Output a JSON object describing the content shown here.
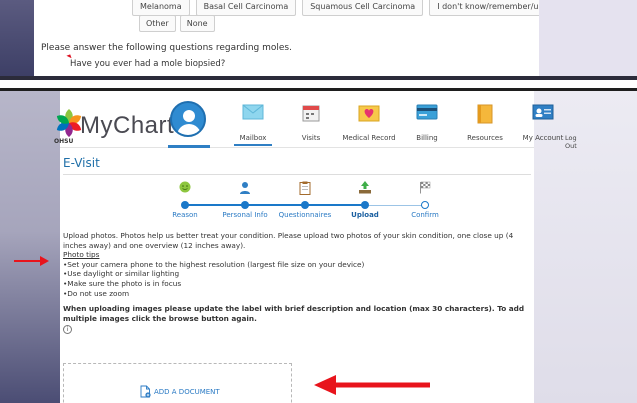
{
  "top_screenshot": {
    "chips_row1": [
      "Melanoma",
      "Basal Cell Carcinoma",
      "Squamous Cell Carcinoma",
      "I don't know/remember/unknown"
    ],
    "chips_row2": [
      "Other",
      "None"
    ],
    "question_intro": "Please answer the following questions regarding moles.",
    "question": "Have you ever had a mole biopsied?"
  },
  "header": {
    "logo_text": "MyChart",
    "logo_org": "OHSU",
    "nav": [
      {
        "label": "Mailbox",
        "icon": "envelope-icon"
      },
      {
        "label": "Visits",
        "icon": "calendar-icon"
      },
      {
        "label": "Medical Record",
        "icon": "heart-folder-icon"
      },
      {
        "label": "Billing",
        "icon": "credit-card-icon"
      },
      {
        "label": "Resources",
        "icon": "book-icon"
      },
      {
        "label": "My Account",
        "icon": "id-card-icon"
      }
    ],
    "logout": "Log Out"
  },
  "page": {
    "title": "E-Visit",
    "steps": [
      {
        "label": "Reason",
        "state": "done"
      },
      {
        "label": "Personal Info",
        "state": "done"
      },
      {
        "label": "Questionnaires",
        "state": "done"
      },
      {
        "label": "Upload",
        "state": "current"
      },
      {
        "label": "Confirm",
        "state": "pending"
      }
    ],
    "intro": "Upload photos. Photos help us better treat your condition. Please upload two photos of your skin condition, one close up (4 inches away) and one overview (12 inches away).",
    "photo_tips_link": "Photo tips",
    "tips": [
      "•Set your camera phone to the highest resolution (largest file size on your device)",
      "•Use daylight or similar lighting",
      "•Make sure the photo is in focus",
      "•Do not use zoom"
    ],
    "upload_note": "When uploading images please update the label with brief description and location (max 30 characters). To add multiple images click the browse button again.",
    "info_glyph": "i",
    "add_document": "ADD A DOCUMENT"
  },
  "colors": {
    "accent": "#1a78c9",
    "title": "#1f6fa8",
    "annotation_arrow": "#e8141c"
  }
}
